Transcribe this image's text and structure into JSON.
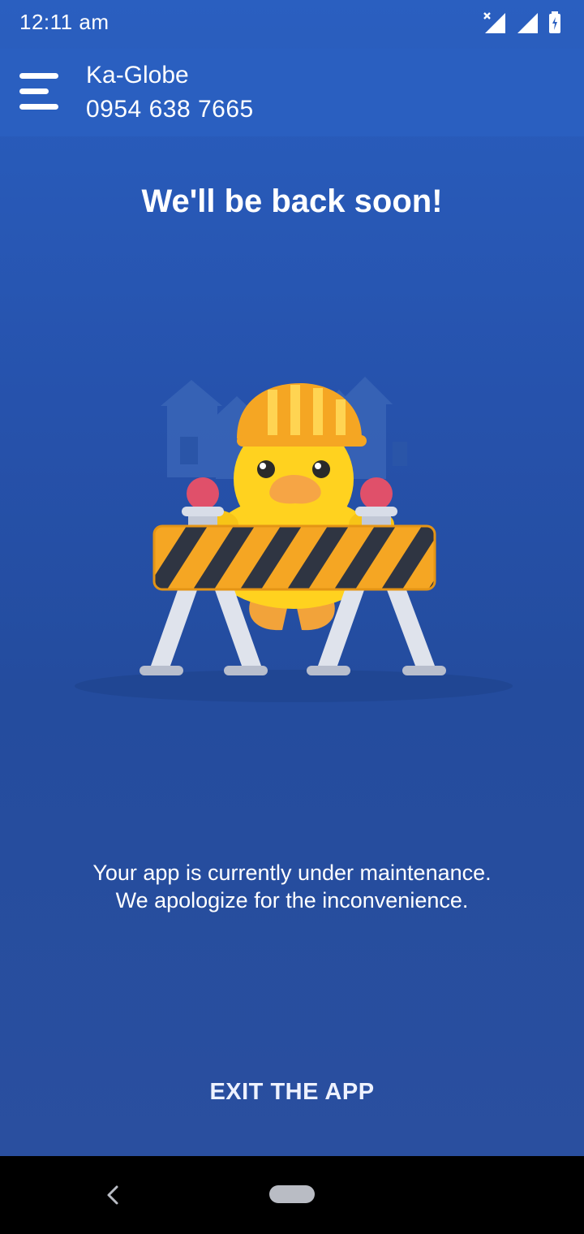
{
  "status_bar": {
    "time": "12:11 am"
  },
  "header": {
    "account_name": "Ka-Globe",
    "account_number": "0954 638 7665"
  },
  "main": {
    "title": "We'll be back soon!",
    "message_line1": "Your app is currently under maintenance.",
    "message_line2": "We apologize for the inconvenience.",
    "exit_label": "EXIT THE APP"
  },
  "icons": {
    "menu": "hamburger-menu-icon",
    "signal_1": "signal-no-data-icon",
    "signal_2": "signal-icon",
    "battery": "battery-charging-icon",
    "back": "back-chevron-icon",
    "home": "home-pill-icon"
  },
  "colors": {
    "background": "#2a5fc0",
    "duck": "#ffd21f",
    "helmet": "#f5a623",
    "barrier_stripe": "#2f3542"
  }
}
